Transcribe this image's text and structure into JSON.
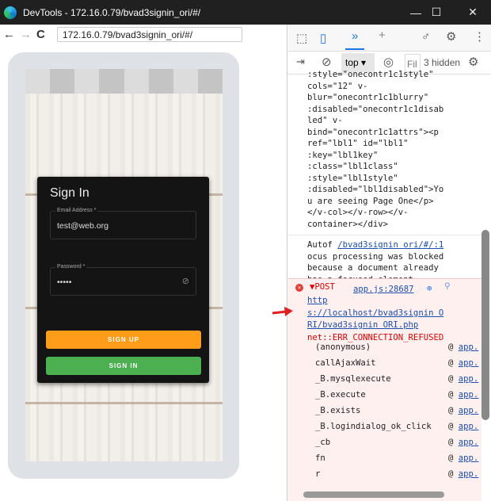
{
  "window": {
    "title": "DevTools - 172.16.0.79/bvad3signin_ori/#/",
    "minimize": "—",
    "maximize": "☐",
    "close": "✕"
  },
  "browser": {
    "url": "172.16.0.79/bvad3signin_ori/#/",
    "back": "←",
    "forward": "→",
    "reload": "C"
  },
  "signin": {
    "title": "Sign In",
    "email_label": "Email Address *",
    "email_value": "test@web.org",
    "password_label": "Password *",
    "password_value": "•••••",
    "signup_label": "SIGN UP",
    "signin_label": "SIGN IN",
    "colors": {
      "signup": "#ff9c1a",
      "signin": "#4caf50"
    }
  },
  "devtools": {
    "context": "top",
    "filter_placeholder": "Fil",
    "hidden": "3 hidden",
    "source_lines": [
      ":style=\"onecontr1c1style\"",
      "cols=\"12\" v-",
      "blur=\"onecontr1c1blurry\"",
      ":disabled=\"onecontr1c1disab",
      "led\" v-",
      "bind=\"onecontr1c1attrs\"><p",
      "ref=\"lbl1\" id=\"lbl1\"",
      ":key=\"lbl1key\"",
      ":class=\"lbl1class\"",
      ":style=\"lbl1style\"",
      ":disabled=\"lbl1disabled\">Yo",
      "u are seeing Page One</p>",
      "</v-col></v-row></v-",
      "container></div>"
    ],
    "autofocus": {
      "prefix": "Autof",
      "link": "/bvad3signin ori/#/:1",
      "lines": [
        "ocus processing was blocked",
        "because a document already",
        "has a focused element."
      ]
    },
    "error": {
      "method": "▼POST",
      "source": "app.js:28687",
      "url_lines": [
        "http",
        "s://localhost/bvad3signin O",
        "RI/bvad3signin ORI.php"
      ],
      "message": "net::ERR_CONNECTION_REFUSED",
      "stack": [
        "(anonymous)",
        "callAjaxWait",
        "_B.mysqlexecute",
        "_B.execute",
        "_B.exists",
        "_B.logindialog_ok_click",
        "_cb",
        "fn",
        "r"
      ],
      "at": "@",
      "at_link": "app."
    }
  }
}
